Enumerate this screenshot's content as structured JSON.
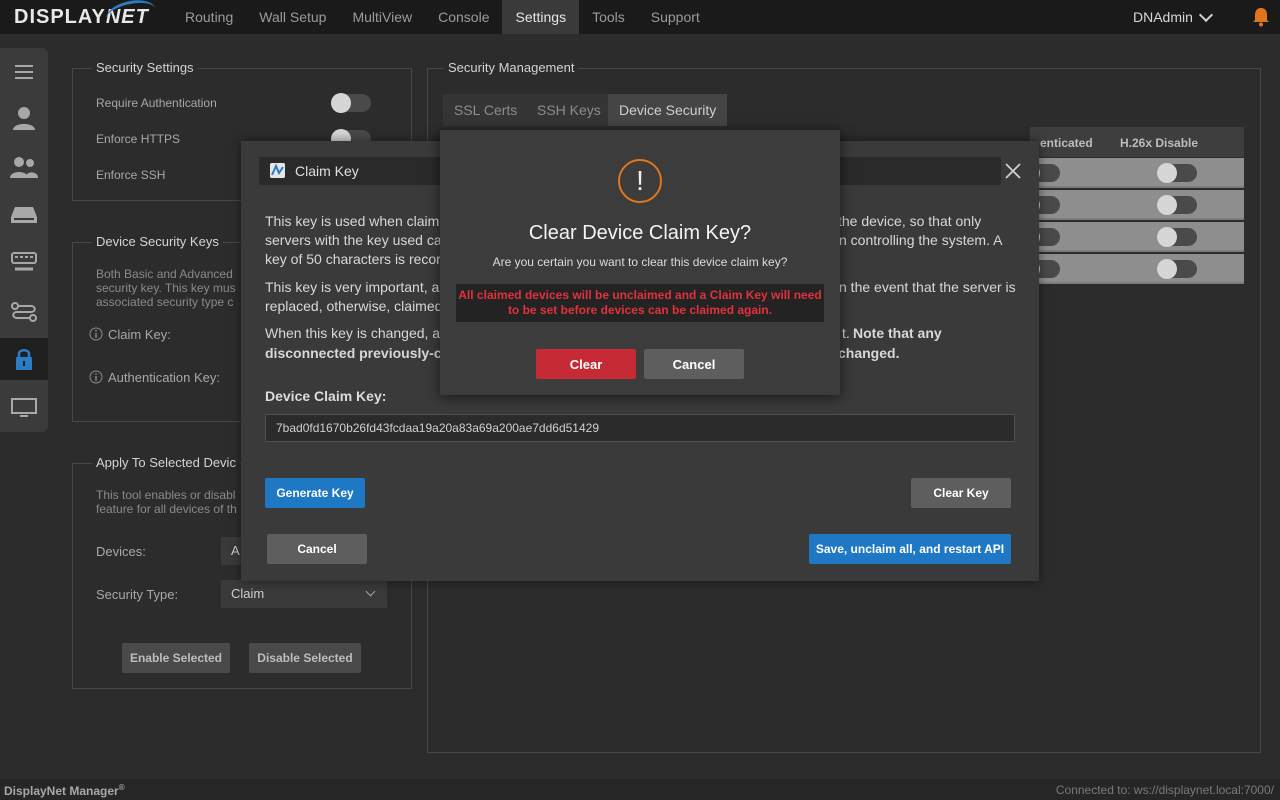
{
  "app": {
    "logo_display": "DISPLAY",
    "logo_net": "NET"
  },
  "nav": {
    "items": [
      "Routing",
      "Wall Setup",
      "MultiView",
      "Console",
      "Settings",
      "Tools",
      "Support"
    ],
    "active": "Settings",
    "user": "DNAdmin"
  },
  "sidebar": {
    "icons": [
      "menu-icon",
      "user-icon",
      "users-icon",
      "server-icon",
      "keyboard-icon",
      "routing-icon",
      "lock-icon",
      "display-icon"
    ],
    "active": "lock-icon"
  },
  "security_settings": {
    "title": "Security Settings",
    "require_auth": "Require Authentication",
    "enforce_https": "Enforce HTTPS",
    "enforce_ssh": "Enforce SSH"
  },
  "device_security_keys": {
    "title": "Device Security Keys",
    "desc1": "Both Basic and Advanced",
    "desc2": "security key. This key mus",
    "desc3": "associated security type c",
    "claim_key": "Claim Key:",
    "auth_key": "Authentication Key:"
  },
  "apply_selected": {
    "title": "Apply To Selected Devic",
    "desc1": "This tool enables or disabl",
    "desc2": "feature for all devices of th",
    "devices_label": "Devices:",
    "devices_value": "A",
    "security_type_label": "Security Type:",
    "security_type_value": "Claim",
    "enable_btn": "Enable Selected",
    "disable_btn": "Disable Selected"
  },
  "security_mgmt": {
    "title": "Security Management",
    "tabs": [
      "SSL Certs",
      "SSH Keys",
      "Device Security"
    ],
    "active_tab": "Device Security",
    "col1": "enticated",
    "col2": "H.26x Disable"
  },
  "claim_modal": {
    "title": "Claim Key",
    "p1_l1a": "This key is used when claimi",
    "p1_l1b": "the device, so that only",
    "p1_l2a": "servers with the key used ca",
    "p1_l2b": "n controlling the system. A",
    "p1_l3a": "key of 50 characters is recor",
    "p2_l1a": "This key is very important, ar",
    "p2_l1b": "n the event that the server is",
    "p2_l2a": "replaced, otherwise, claimed",
    "p3_l1a": "When this key is changed, al",
    "p3_l1b": "t.",
    "p3_l1c": "Note that any",
    "p3_l2a": "disconnected previously-cla",
    "p3_l2b": "changed.",
    "key_label": "Device Claim Key:",
    "key_value": "7bad0fd1670b26fd43fcdaa19a20a83a69a200ae7dd6d51429",
    "generate_btn": "Generate Key",
    "clear_key_btn": "Clear Key",
    "cancel_btn": "Cancel",
    "save_btn": "Save, unclaim all, and restart API"
  },
  "confirm": {
    "icon": "!",
    "title": "Clear Device Claim Key?",
    "subtitle": "Are you certain you want to clear this device claim key?",
    "warning": "All claimed devices will be unclaimed and a Claim Key will need to be set before devices can be claimed again.",
    "clear_btn": "Clear",
    "cancel_btn": "Cancel",
    "accent_color": "#e2761c",
    "danger_color": "#c62b35"
  },
  "footer": {
    "product": "DisplayNet Manager",
    "reg": "®",
    "connection": "Connected to: ws://displaynet.local:7000/"
  }
}
